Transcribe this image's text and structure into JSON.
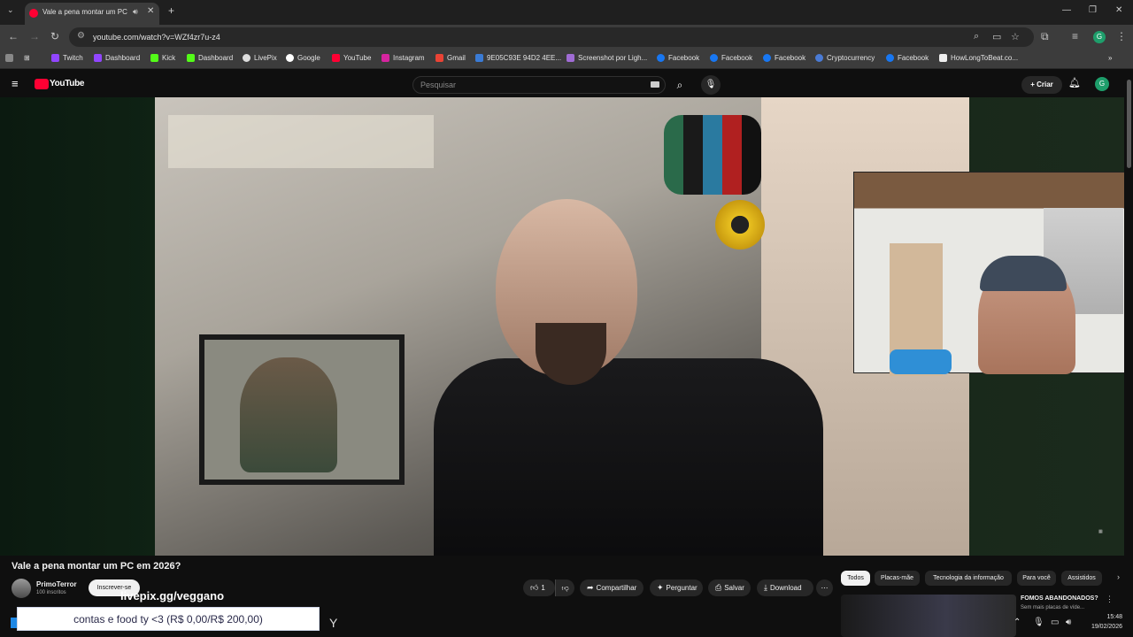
{
  "browser": {
    "tab_title": "Vale a pena montar um PC",
    "url": "youtube.com/watch?v=WZf4zr7u-z4",
    "bookmarks": [
      "Twitch",
      "Dashboard",
      "Kick",
      "Dashboard",
      "LivePix",
      "Google",
      "YouTube",
      "Instagram",
      "Gmail",
      "9E05C93E 94D2 4EE...",
      "Screenshot por Ligh...",
      "Facebook",
      "Facebook",
      "Facebook",
      "Cryptocurrency",
      "Facebook",
      "HowLongToBeat.co..."
    ]
  },
  "youtube": {
    "logo": "YouTube",
    "search_placeholder": "Pesquisar",
    "create_label": "Criar",
    "avatar_letter": "G"
  },
  "video": {
    "title": "Vale a pena montar um PC em 2026?",
    "channel": "PrimoTerror",
    "subscribers": "100 inscritos",
    "subscribe_label": "Inscrever-se",
    "overlay_link": "livepix.gg/veggano",
    "likes": "1",
    "share_label": "Compartilhar",
    "ask_label": "Perguntar",
    "save_label": "Salvar",
    "download_label": "Download",
    "goal_text": "contas e food ty <3 (R$ 0,00/R$ 200,00)"
  },
  "chips": [
    "Todos",
    "Placas-mãe",
    "Tecnologia da informação",
    "Para você",
    "Assistidos"
  ],
  "recommendation": {
    "title": "FOMOS ABANDONADOS?",
    "subtitle": "Sem mais placas de víde..."
  },
  "clock": {
    "time": "15:48",
    "date": "19/02/2026"
  }
}
